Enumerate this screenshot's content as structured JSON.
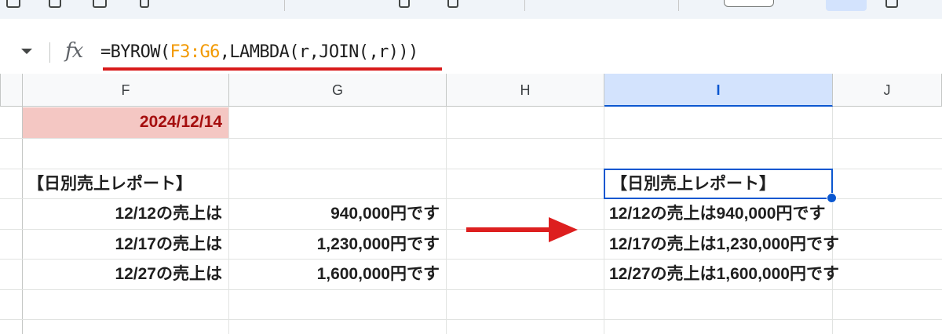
{
  "formula_bar": {
    "fx": "fx",
    "prefix": "=BYROW(",
    "range": "F3:G6",
    "suffix": ",LAMBDA(r,JOIN(,r)))"
  },
  "columns": [
    "F",
    "G",
    "H",
    "I",
    "J"
  ],
  "selected_column": "I",
  "cells": {
    "F1": "2024/12/14",
    "F3": "【日別売上レポート】",
    "F4": "12/12の売上は",
    "G4": "940,000円です",
    "F5": "12/17の売上は",
    "G5": "1,230,000円です",
    "F6": "12/27の売上は",
    "G6": "1,600,000円です",
    "I3": "【日別売上レポート】",
    "I4": "12/12の売上は940,000円です",
    "I5": "12/17の売上は1,230,000円です",
    "I6": "12/27の売上は1,600,000円です"
  },
  "colors": {
    "formula_range": "#f29900",
    "underline": "#d81b1b",
    "arrow": "#dd1f1f",
    "date_fill": "#f4c7c3",
    "date_text": "#a50e0e",
    "selection": "#0b57d0"
  },
  "icons": [
    "dropdown-arrow-icon",
    "fx-icon",
    "right-arrow-icon"
  ]
}
